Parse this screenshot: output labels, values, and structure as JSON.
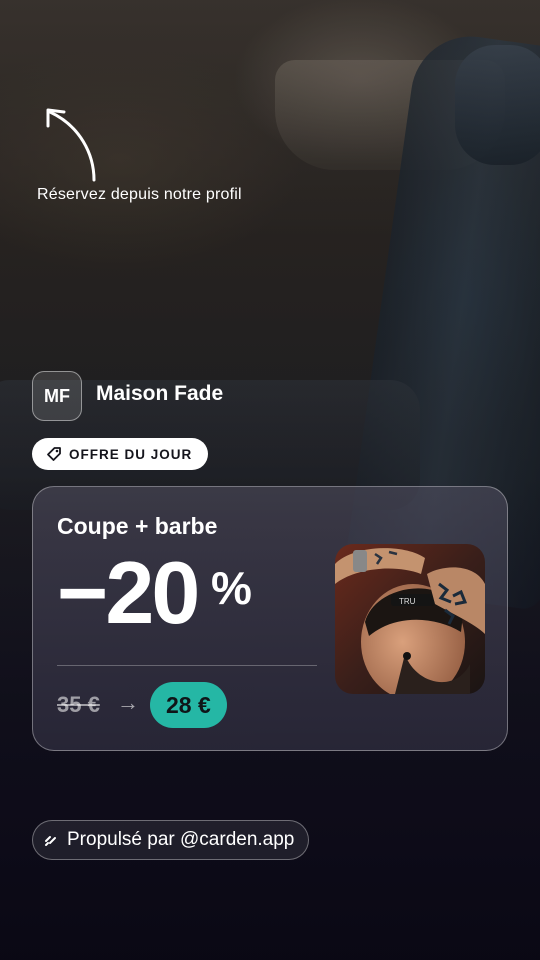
{
  "hint": {
    "text": "Réservez depuis notre profil"
  },
  "brand": {
    "initials": "MF",
    "name": "Maison Fade"
  },
  "offer": {
    "badge_label": "OFFRE DU JOUR",
    "service": "Coupe + barbe",
    "discount": "−20",
    "percent": "%",
    "old_price": "35 €",
    "arrow": "→",
    "new_price": "28 €"
  },
  "footer": {
    "powered_by": "Propulsé par @carden.app"
  },
  "icons": {
    "arrow": "curved-arrow-up-icon",
    "tag": "tag-icon",
    "spark": "spark-icon"
  },
  "colors": {
    "accent": "#25b7a5",
    "pill_bg": "#ffffff",
    "text": "#ffffff"
  }
}
